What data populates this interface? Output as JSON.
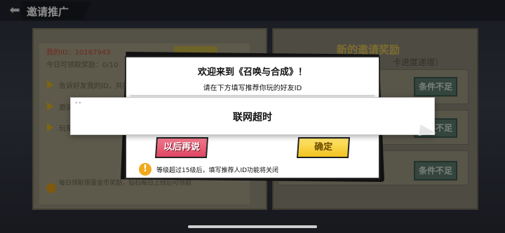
{
  "header": {
    "back_icon": "back-arrow-icon",
    "title": "邀请推广"
  },
  "left_panel": {
    "uid": "我的ID：10167943",
    "today": "今日可领取奖励：0/10",
    "steps": [
      "告诉好友我的ID，共同",
      "邀请",
      "玩家"
    ],
    "footer_note": "每日领取限量金币奖励，钻石每日上线后可领取"
  },
  "right_panel": {
    "title": "新的邀请奖励",
    "subtitle": "卡进度递增）",
    "condition_label": "条件不足",
    "rows": 3
  },
  "dialog": {
    "title": "欢迎来到《召唤与合成》！",
    "subtitle": "请在下方填写推荐你玩的好友ID",
    "later_button": "以后再说",
    "ok_button": "确定",
    "warning_icon": "exclamation-icon",
    "warning": "等级超过15级后，填写推荐人ID功能将关闭"
  },
  "toast": {
    "message": "联网超时"
  },
  "colors": {
    "later": "#e04463",
    "ok": "#f2c320",
    "warning": "#f1a91c"
  }
}
